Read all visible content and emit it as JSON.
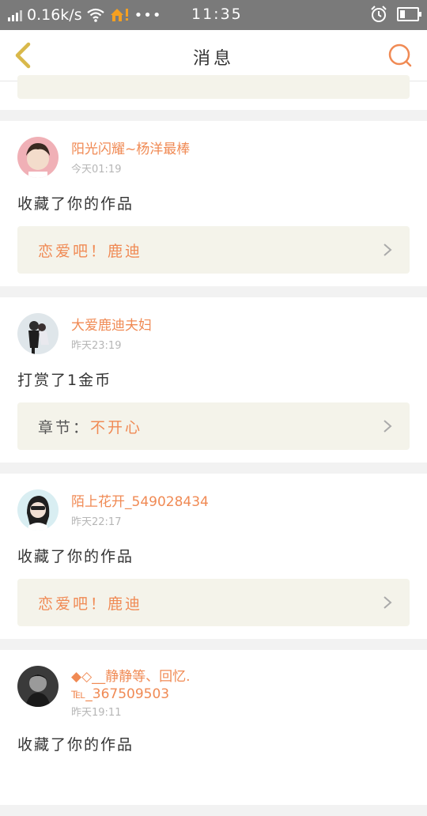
{
  "status_bar": {
    "speed": "0.16k/s",
    "time": "11:35"
  },
  "header": {
    "title": "消息"
  },
  "messages": [
    {
      "name": "阳光闪耀~杨洋最棒",
      "time": "今天01:19",
      "action": "收藏了你的作品",
      "link_prefix": "",
      "link_text": "恋爱吧！鹿迪"
    },
    {
      "name": "大爱鹿迪夫妇",
      "time": "昨天23:19",
      "action": "打赏了1金币",
      "link_prefix": "章节：",
      "link_text": "不开心"
    },
    {
      "name": "陌上花开_549028434",
      "time": "昨天22:17",
      "action": "收藏了你的作品",
      "link_prefix": "",
      "link_text": "恋爱吧！鹿迪"
    },
    {
      "name": "◆◇__静静等、回忆.",
      "name_line2": "℡_367509503",
      "time": "昨天19:11",
      "action": "收藏了你的作品"
    }
  ],
  "colors": {
    "accent": "#f08a54",
    "back_arrow": "#d9b84a",
    "link_bg": "#f4f3ea"
  }
}
